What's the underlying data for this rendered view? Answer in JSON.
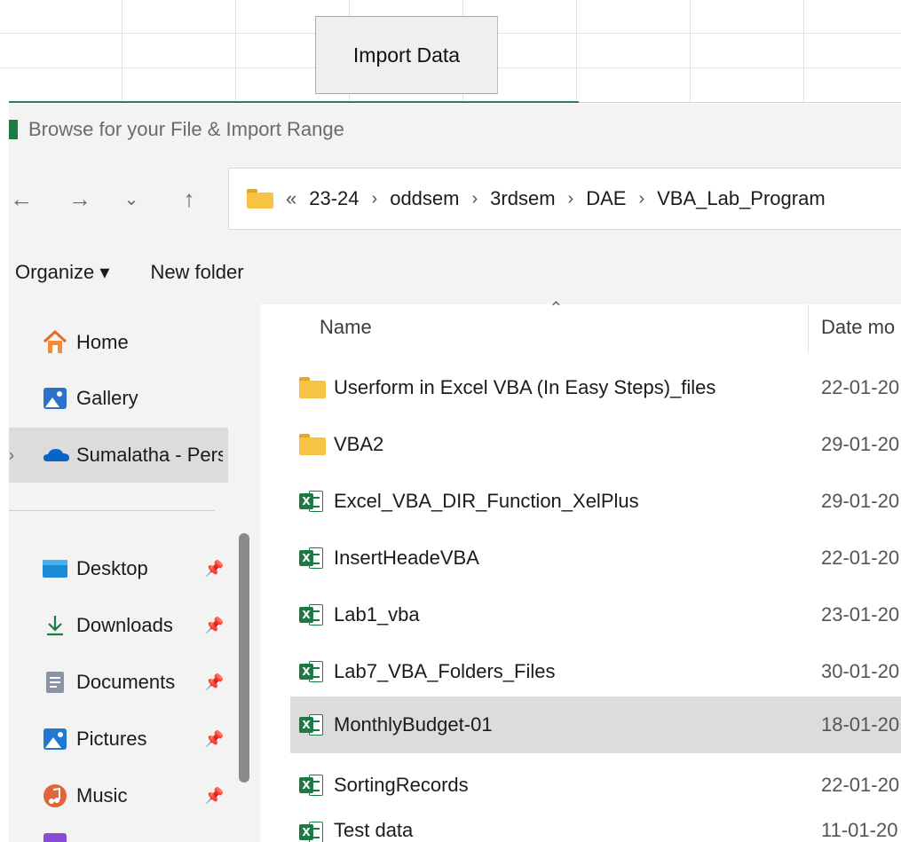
{
  "excel": {
    "import_button": "Import Data"
  },
  "dialog": {
    "title": "Browse for your File & Import Range",
    "nav": {
      "back": "←",
      "forward": "→",
      "recent": "⌄",
      "up": "↑"
    },
    "address": {
      "overflow": "«",
      "crumbs": [
        "23-24",
        "oddsem",
        "3rdsem",
        "DAE",
        "VBA_Lab_Program"
      ],
      "separator": "›"
    },
    "commands": {
      "organize": "Organize ▾",
      "new_folder": "New folder"
    },
    "navpane": {
      "items": [
        {
          "label": "Home",
          "icon": "home-icon"
        },
        {
          "label": "Gallery",
          "icon": "gallery-icon"
        },
        {
          "label": "Sumalatha - Pers",
          "icon": "onedrive-icon",
          "selected": true
        },
        {
          "label": "Desktop",
          "icon": "desktop-icon",
          "pinned": true
        },
        {
          "label": "Downloads",
          "icon": "download-icon",
          "pinned": true
        },
        {
          "label": "Documents",
          "icon": "documents-icon",
          "pinned": true
        },
        {
          "label": "Pictures",
          "icon": "pictures-icon",
          "pinned": true
        },
        {
          "label": "Music",
          "icon": "music-icon",
          "pinned": true
        }
      ]
    },
    "filelist": {
      "columns": {
        "name": "Name",
        "date": "Date mo"
      },
      "rows": [
        {
          "name": "Userform in Excel VBA (In Easy Steps)_files",
          "date": "22-01-20",
          "type": "folder"
        },
        {
          "name": "VBA2",
          "date": "29-01-20",
          "type": "folder"
        },
        {
          "name": "Excel_VBA_DIR_Function_XelPlus",
          "date": "29-01-20",
          "type": "xlsm"
        },
        {
          "name": "InsertHeadeVBA",
          "date": "22-01-20",
          "type": "xlsm"
        },
        {
          "name": "Lab1_vba",
          "date": "23-01-20",
          "type": "xlsm"
        },
        {
          "name": "Lab7_VBA_Folders_Files",
          "date": "30-01-20",
          "type": "xlsm"
        },
        {
          "name": "MonthlyBudget-01",
          "date": "18-01-20",
          "type": "xlsx",
          "selected": true
        },
        {
          "name": "SortingRecords",
          "date": "22-01-20",
          "type": "xlsm"
        },
        {
          "name": "Test data",
          "date": "11-01-20",
          "type": "xlsx"
        }
      ]
    }
  },
  "colors": {
    "excel_green": "#1e7a45",
    "folder_yellow": "#f6c344",
    "selection": "#dcdcdc"
  }
}
